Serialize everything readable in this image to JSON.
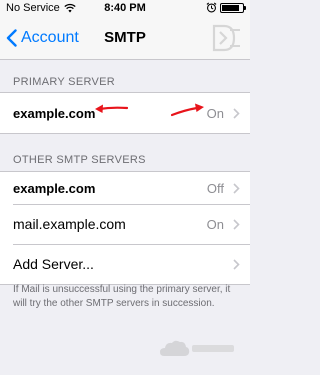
{
  "status_bar": {
    "carrier": "No Service",
    "time": "8:40 PM",
    "battery_level": 0.85
  },
  "nav": {
    "back_label": "Account",
    "title": "SMTP"
  },
  "primary_server": {
    "header": "PRIMARY SERVER",
    "server": "example.com",
    "status": "On"
  },
  "other_servers": {
    "header": "OTHER SMTP SERVERS",
    "items": [
      {
        "server": "example.com",
        "status": "Off"
      },
      {
        "server": "mail.example.com",
        "status": "On"
      }
    ],
    "add_label": "Add Server..."
  },
  "footer_note": "If Mail is unsuccessful using the primary server, it will try the other SMTP servers in succession.",
  "annotation_color": "#e8141b",
  "accent_color": "#007aff"
}
